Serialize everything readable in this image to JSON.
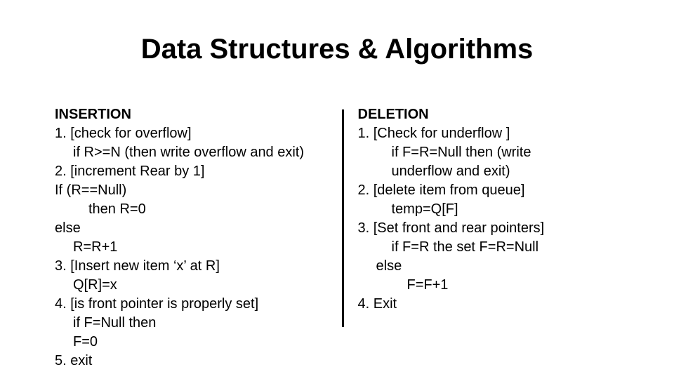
{
  "title": "Data Structures & Algorithms",
  "left": {
    "heading": "INSERTION",
    "l1": "1. [check for overflow]",
    "l2": "if R>=N (then write overflow and exit)",
    "l3": "2. [increment Rear by 1]",
    "l4": "If (R==Null)",
    "l5": "then R=0",
    "l6": "else",
    "l7": "R=R+1",
    "l8": "3. [Insert new item ‘x’ at R]",
    "l9": "Q[R]=x",
    "l10": "4. [is front pointer is properly set]",
    "l11": "if F=Null then",
    "l12": "F=0",
    "l13": "5. exit"
  },
  "right": {
    "heading": "DELETION",
    "l1": "1.   [Check for underflow ]",
    "l2": "if F=R=Null then (write",
    "l3": "underflow and exit)",
    "l4": "2. [delete item from queue]",
    "l5": "temp=Q[F]",
    "l6": "3. [Set front and rear pointers]",
    "l7": "if F=R the set F=R=Null",
    "l8": "else",
    "l9": "F=F+1",
    "l10": "4. Exit"
  }
}
